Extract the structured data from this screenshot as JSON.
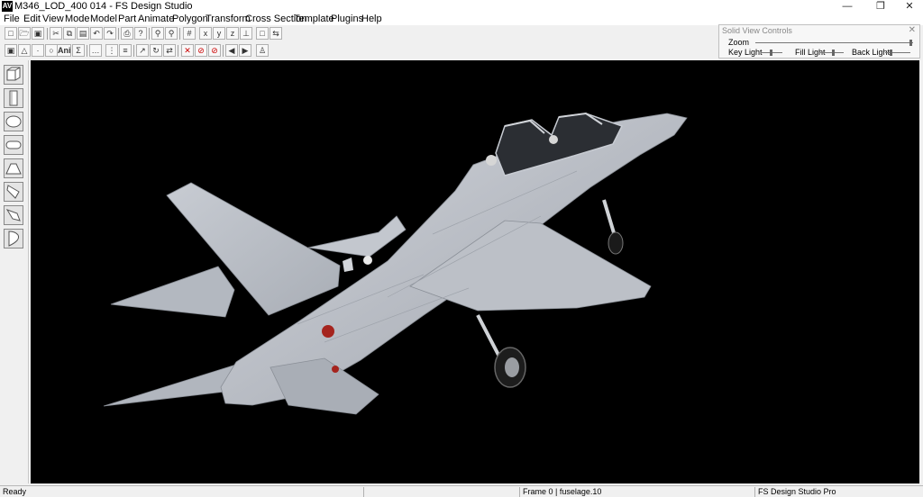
{
  "window": {
    "title": "M346_LOD_400 014 - FS Design Studio",
    "icon_label": "AV",
    "controls": [
      "minimize-icon",
      "restore-icon",
      "close-icon"
    ]
  },
  "menu": [
    "File",
    "Edit",
    "View",
    "Mode",
    "Model",
    "Part",
    "Animate",
    "Polygon",
    "Transform",
    "Cross Section",
    "Template",
    "Plugins",
    "Help"
  ],
  "toolbar": {
    "ani_label": "Ani"
  },
  "solid_view_controls": {
    "title": "Solid View Controls",
    "zoom_label": "Zoom",
    "key_light_label": "Key Light",
    "fill_light_label": "Fill Light",
    "back_light_label": "Back Light",
    "zoom_level": 0.98,
    "key_light_level": 0.45,
    "fill_light_level": 0.55,
    "back_light_level": 0.2
  },
  "status": {
    "left": "Ready",
    "frame": "Frame 0 | fuselage.10",
    "product": "FS Design Studio Pro"
  },
  "colors": {
    "viewport_bg": "#000000",
    "aircraft_body": "#b7bbc3",
    "roundel": "#a5241e"
  }
}
